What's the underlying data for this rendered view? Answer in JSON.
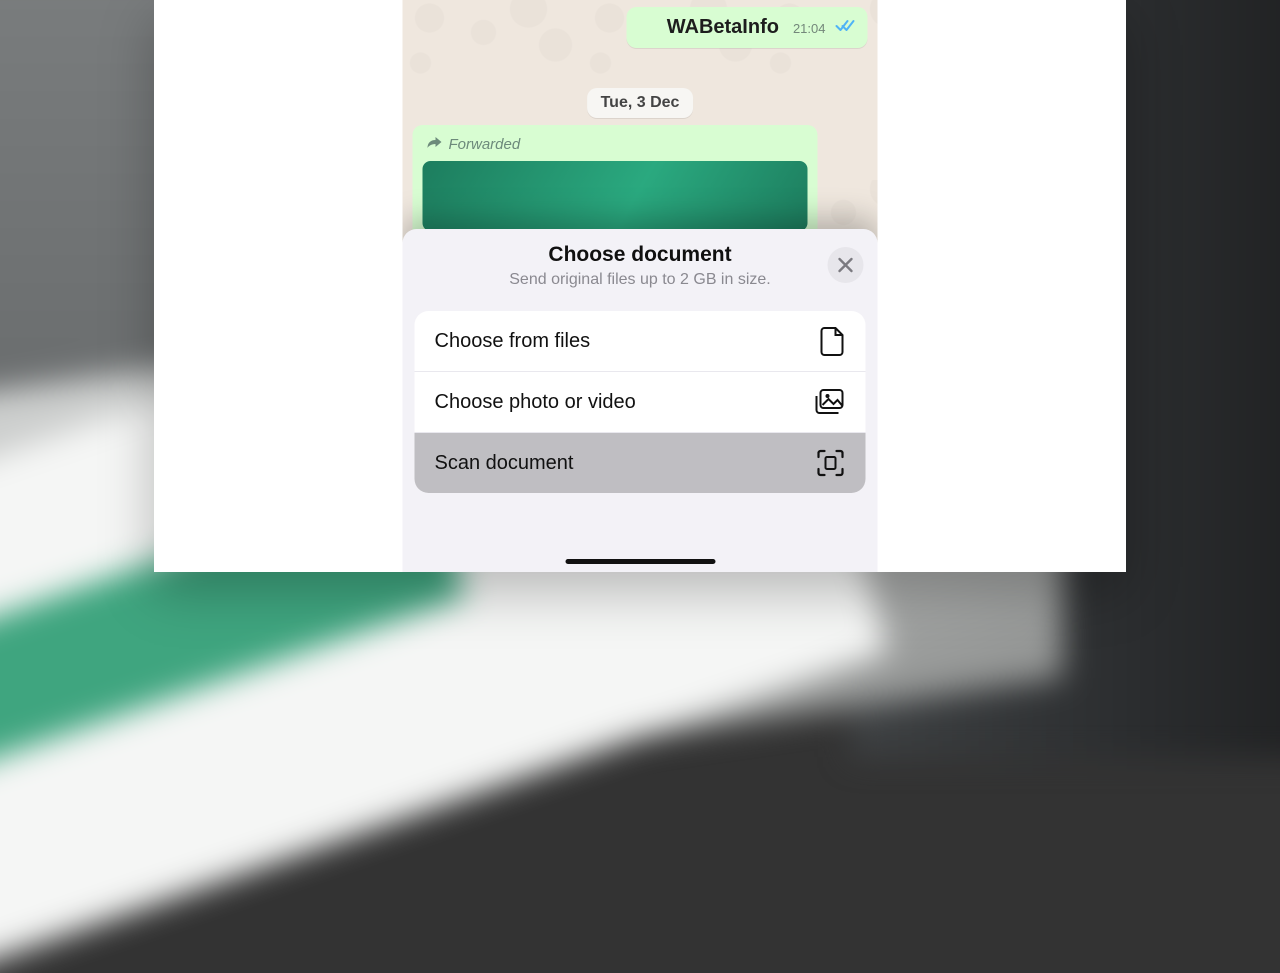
{
  "chat": {
    "sent_message": "WABetaInfo",
    "sent_time": "21:04",
    "date_pill": "Tue, 3 Dec",
    "forwarded_label": "Forwarded"
  },
  "sheet": {
    "title": "Choose document",
    "subtitle": "Send original files up to 2 GB in size.",
    "options": [
      {
        "label": "Choose from files"
      },
      {
        "label": "Choose photo or video"
      },
      {
        "label": "Scan document"
      }
    ]
  }
}
